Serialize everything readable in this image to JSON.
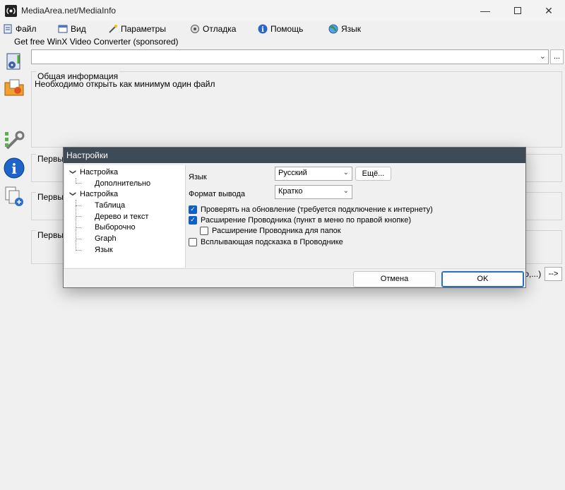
{
  "window": {
    "title": "MediaArea.net/MediaInfo"
  },
  "menu": [
    {
      "label": "Файл",
      "icon": "file-icon"
    },
    {
      "label": "Вид",
      "icon": "view-icon"
    },
    {
      "label": "Параметры",
      "icon": "wand-icon"
    },
    {
      "label": "Отладка",
      "icon": "debug-icon"
    },
    {
      "label": "Помощь",
      "icon": "help-icon"
    },
    {
      "label": "Язык",
      "icon": "globe-icon"
    }
  ],
  "sponsored": "Get free WinX Video Converter (sponsored)",
  "main": {
    "general_title": "Общая информация",
    "general_text": "Необходимо открыть как минимум один файл",
    "group2_title": "Первы",
    "group3_title": "Первы",
    "group4_title": "Первы",
    "status_text": "во,...)",
    "arrow_label": "-->"
  },
  "dialog": {
    "title": "Настройки",
    "tree": [
      {
        "label": "Настройка",
        "level": 0
      },
      {
        "label": "Дополнительно",
        "level": 1
      },
      {
        "label": "Настройка",
        "level": 0
      },
      {
        "label": "Таблица",
        "level": 1
      },
      {
        "label": "Дерево и текст",
        "level": 1
      },
      {
        "label": "Выборочно",
        "level": 1
      },
      {
        "label": "Graph",
        "level": 1
      },
      {
        "label": "Язык",
        "level": 1
      }
    ],
    "language_label": "Язык",
    "language_value": "Русский",
    "more_button": "Ещё...",
    "format_label": "Формат вывода",
    "format_value": "Кратко",
    "checkboxes": [
      {
        "label": "Проверять на обновление (требуется подключение к интернету)",
        "checked": true
      },
      {
        "label": "Расширение Проводника (пункт в меню по правой кнопке)",
        "checked": true
      },
      {
        "label": "Расширение Проводника для папок",
        "checked": false
      },
      {
        "label": "Всплывающая подсказка в Проводнике",
        "checked": false
      }
    ],
    "cancel_button": "Отмена",
    "ok_button": "OK"
  }
}
